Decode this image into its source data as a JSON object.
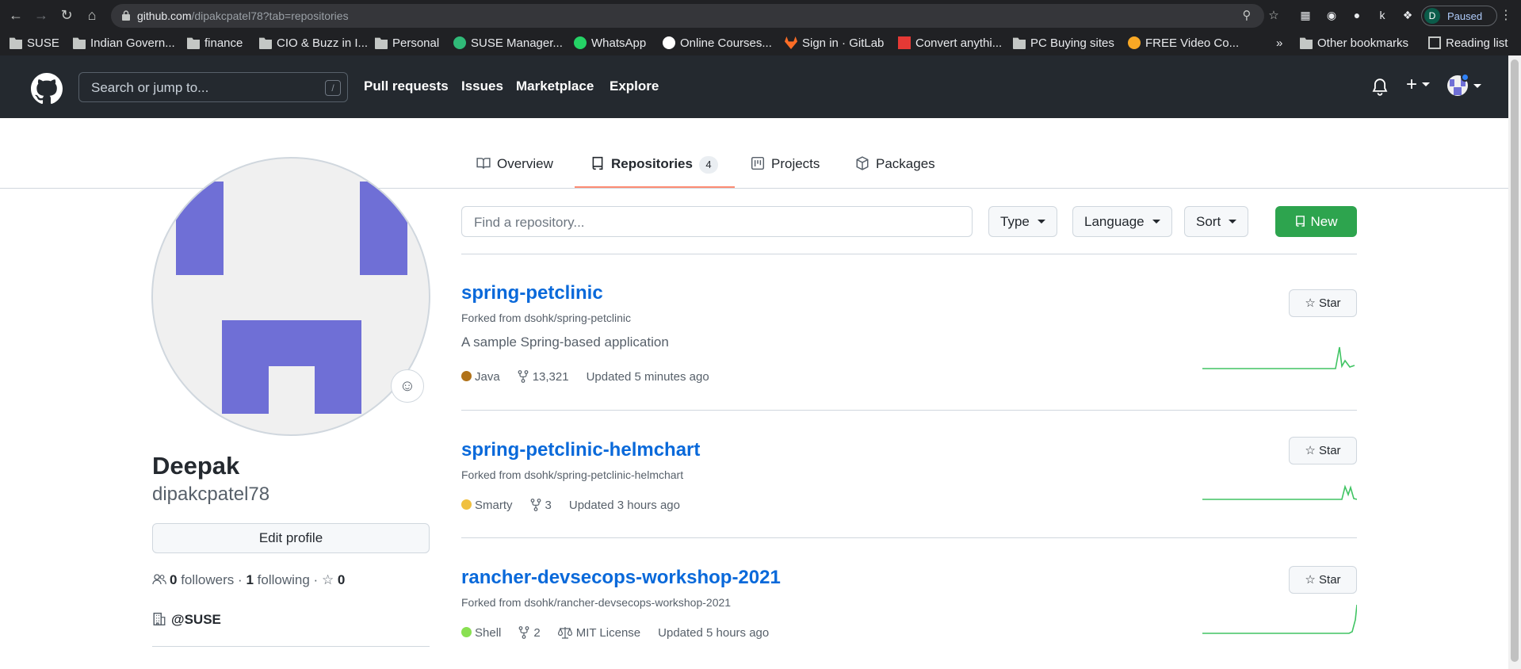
{
  "browser": {
    "url_host": "github.com",
    "url_path": "/dipakcpatel78?tab=repositories",
    "profile_initial": "D",
    "profile_status": "Paused",
    "extension_k": "k",
    "bookmarks": [
      {
        "label": "SUSE",
        "icon": "folder"
      },
      {
        "label": "Indian Govern...",
        "icon": "folder"
      },
      {
        "label": "finance",
        "icon": "folder"
      },
      {
        "label": "CIO & Buzz in I...",
        "icon": "folder"
      },
      {
        "label": "Personal",
        "icon": "folder"
      },
      {
        "label": "SUSE Manager...",
        "icon": "suse-favicon"
      },
      {
        "label": "WhatsApp",
        "icon": "whatsapp-favicon"
      },
      {
        "label": "Online Courses...",
        "icon": "courses-favicon"
      },
      {
        "label": "Sign in · GitLab",
        "icon": "gitlab-favicon"
      },
      {
        "label": "Convert anythi...",
        "icon": "pdf-favicon"
      },
      {
        "label": "PC Buying sites",
        "icon": "folder"
      },
      {
        "label": "FREE Video Co...",
        "icon": "video-favicon"
      }
    ],
    "overflow": "»",
    "other_bookmarks": "Other bookmarks",
    "reading_list": "Reading list"
  },
  "header": {
    "search_placeholder": "Search or jump to...",
    "search_shortcut": "/",
    "nav": [
      "Pull requests",
      "Issues",
      "Marketplace",
      "Explore"
    ],
    "plus": "+"
  },
  "tabs": [
    {
      "label": "Overview",
      "icon": "book-icon"
    },
    {
      "label": "Repositories",
      "icon": "repo-icon",
      "count": "4",
      "active": true
    },
    {
      "label": "Projects",
      "icon": "project-icon"
    },
    {
      "label": "Packages",
      "icon": "package-icon"
    }
  ],
  "profile": {
    "name": "Deepak",
    "login": "dipakcpatel78",
    "edit_label": "Edit profile",
    "followers_count": "0",
    "followers_label": "followers",
    "separator": "·",
    "following_count": "1",
    "following_label": "following",
    "stars_count": "0",
    "org": "@SUSE",
    "avatar_color": "#6f6fd6"
  },
  "toolbar": {
    "find_placeholder": "Find a repository...",
    "type_label": "Type",
    "language_label": "Language",
    "sort_label": "Sort",
    "new_label": "New"
  },
  "repos": [
    {
      "name": "spring-petclinic",
      "fork_prefix": "Forked from",
      "fork_source": "dsohk/spring-petclinic",
      "description": "A sample Spring-based application",
      "language": "Java",
      "language_color": "#b07219",
      "forks": "13,321",
      "license": "",
      "updated": "Updated 5 minutes ago",
      "star_label": "Star"
    },
    {
      "name": "spring-petclinic-helmchart",
      "fork_prefix": "Forked from",
      "fork_source": "dsohk/spring-petclinic-helmchart",
      "description": "",
      "language": "Smarty",
      "language_color": "#f0c040",
      "forks": "3",
      "license": "",
      "updated": "Updated 3 hours ago",
      "star_label": "Star"
    },
    {
      "name": "rancher-devsecops-workshop-2021",
      "fork_prefix": "Forked from",
      "fork_source": "dsohk/rancher-devsecops-workshop-2021",
      "description": "",
      "language": "Shell",
      "language_color": "#89e051",
      "forks": "2",
      "license": "MIT License",
      "updated": "Updated 5 hours ago",
      "star_label": "Star"
    }
  ],
  "colors": {
    "link": "#0969da",
    "header_bg": "#24292f",
    "new_button": "#2da44e",
    "active_tab_underline": "#fd8c73",
    "sparkline": "#40c463"
  }
}
